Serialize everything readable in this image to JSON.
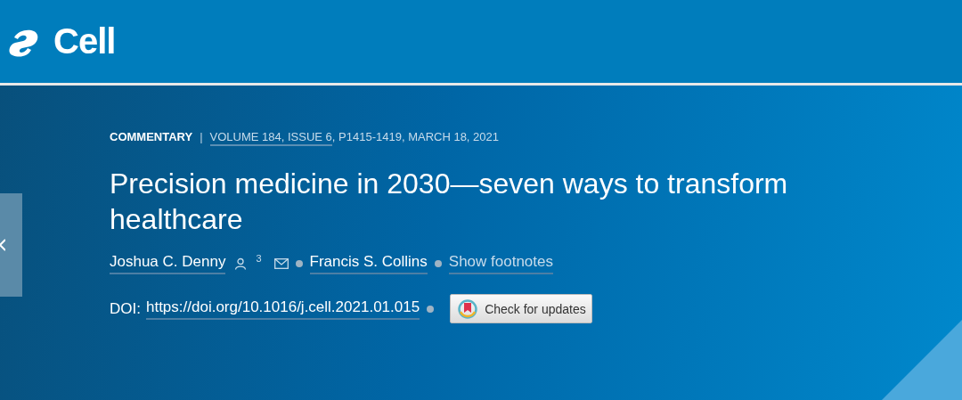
{
  "brand": {
    "name": "Cell"
  },
  "meta": {
    "article_type": "COMMENTARY",
    "separator": "|",
    "issue_link": "VOLUME 184, ISSUE 6",
    "details": ", P1415-1419, MARCH 18, 2021"
  },
  "title": "Precision medicine in 2030—seven ways to transform healthcare",
  "authors": [
    {
      "name": "Joshua C. Denny",
      "affiliation": "3",
      "has_profile": true,
      "has_email": true
    },
    {
      "name": "Francis S. Collins",
      "has_profile": false,
      "has_email": false
    }
  ],
  "footnotes_link": "Show footnotes",
  "doi": {
    "label": "DOI:",
    "link": "https://doi.org/10.1016/j.cell.2021.01.015"
  },
  "updates_button": "Check for updates"
}
